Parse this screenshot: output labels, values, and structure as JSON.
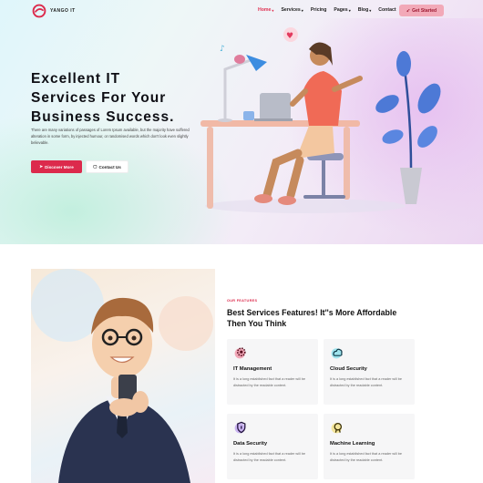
{
  "brand": {
    "name": "YANGO IT",
    "accent": "#dc2a4c"
  },
  "nav": {
    "items": [
      {
        "label": "Home",
        "dropdown": true,
        "active": true
      },
      {
        "label": "Services",
        "dropdown": true
      },
      {
        "label": "Pricing",
        "dropdown": false
      },
      {
        "label": "Pages",
        "dropdown": true
      },
      {
        "label": "Blog",
        "dropdown": true
      },
      {
        "label": "Contact",
        "dropdown": false
      }
    ],
    "cta_label": "Get Started"
  },
  "hero": {
    "title_lines": [
      "Excellent IT",
      "Services For Your",
      "Business Success."
    ],
    "description": "There are many variations of passages of Lorem Ipsum available, but the majority have suffered alteration in some form, by injected humour, or randomised words which don't look even slightly believable.",
    "primary_button": "Discover More",
    "secondary_button": "Contact Us"
  },
  "features": {
    "tag": "OUR FEATURES",
    "title": "Best Services Features! It''s More Affordable Then You Think",
    "cards": [
      {
        "title": "IT Management",
        "text": "It is a long established fact that a reader will be distracted by the readable content.",
        "icon": "gear-icon",
        "icon_color": "#f1a7b7"
      },
      {
        "title": "Cloud Security",
        "text": "It is a long established fact that a reader will be distracted by the readable content.",
        "icon": "cloud-icon",
        "icon_color": "#9fe4ee"
      },
      {
        "title": "Data Security",
        "text": "It is a long established fact that a reader will be distracted by the readable content.",
        "icon": "shield-icon",
        "icon_color": "#c9b3f0"
      },
      {
        "title": "Machine Learning",
        "text": "It is a long established fact that a reader will be distracted by the readable content.",
        "icon": "ml-icon",
        "icon_color": "#f3e59b"
      }
    ]
  }
}
